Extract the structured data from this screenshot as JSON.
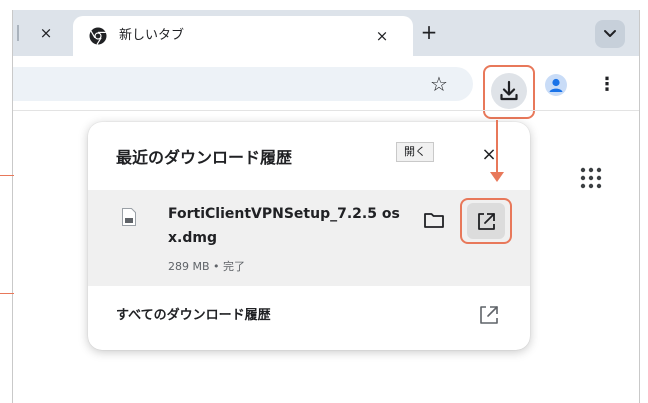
{
  "tabs": {
    "active_title": "新しいタブ",
    "close_glyph": "×",
    "new_tab_glyph": "+",
    "search_glyph": "⌄"
  },
  "toolbar": {
    "star_glyph": "☆",
    "menu_glyph": "⋮"
  },
  "downloads_popup": {
    "title": "最近のダウンロード履歴",
    "close_glyph": "×",
    "item": {
      "file_name": "FortiClientVPNSetup_7.2.5 osx.dmg",
      "status": "289 MB • 完了"
    },
    "tooltip": "開く",
    "all_downloads_label": "すべてのダウンロード履歴"
  },
  "icons": {
    "favicon": "chrome-icon",
    "download": "download-icon",
    "profile": "profile-icon",
    "apps": "apps-grid-icon",
    "file": "file-icon",
    "folder": "folder-icon",
    "open": "open-external-icon"
  },
  "colors": {
    "highlight": "#e8785a",
    "tabstrip": "#dde3ea",
    "omnibox": "#edf2f7",
    "item_row": "#f0f0f0"
  }
}
